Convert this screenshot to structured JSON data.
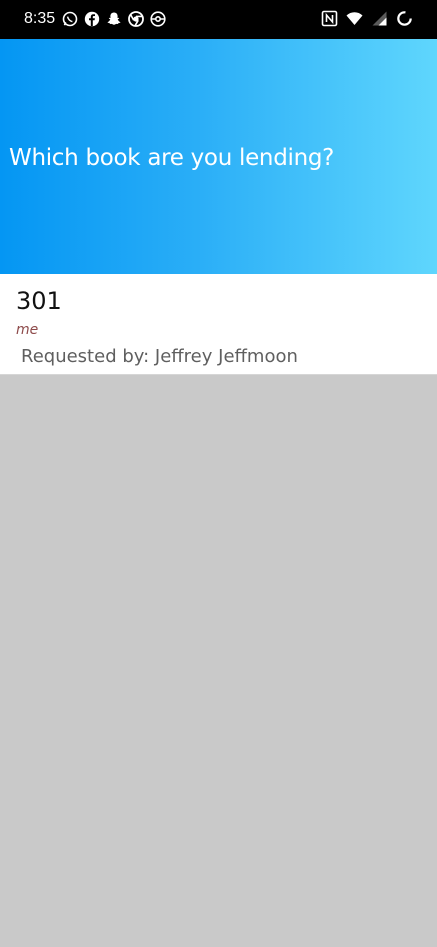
{
  "status_bar": {
    "time": "8:35",
    "left_icons": [
      "whatsapp-icon",
      "facebook-icon",
      "snapchat-icon",
      "chrome-icon",
      "pokeball-icon"
    ],
    "right_icons": [
      "nfc-icon",
      "wifi-icon",
      "signal-icon",
      "battery-loading-icon"
    ]
  },
  "header": {
    "title": "Which book are you lending?",
    "gradient": [
      "#0496f3",
      "#5fd6fd"
    ]
  },
  "books": [
    {
      "title": "301",
      "owner": "me",
      "requested_by": "Requested by: Jeffrey Jeffmoon"
    }
  ],
  "colors": {
    "background": "#c9c9c9",
    "owner_text": "#8e4b4b",
    "requested_text": "#5f5f5f"
  }
}
